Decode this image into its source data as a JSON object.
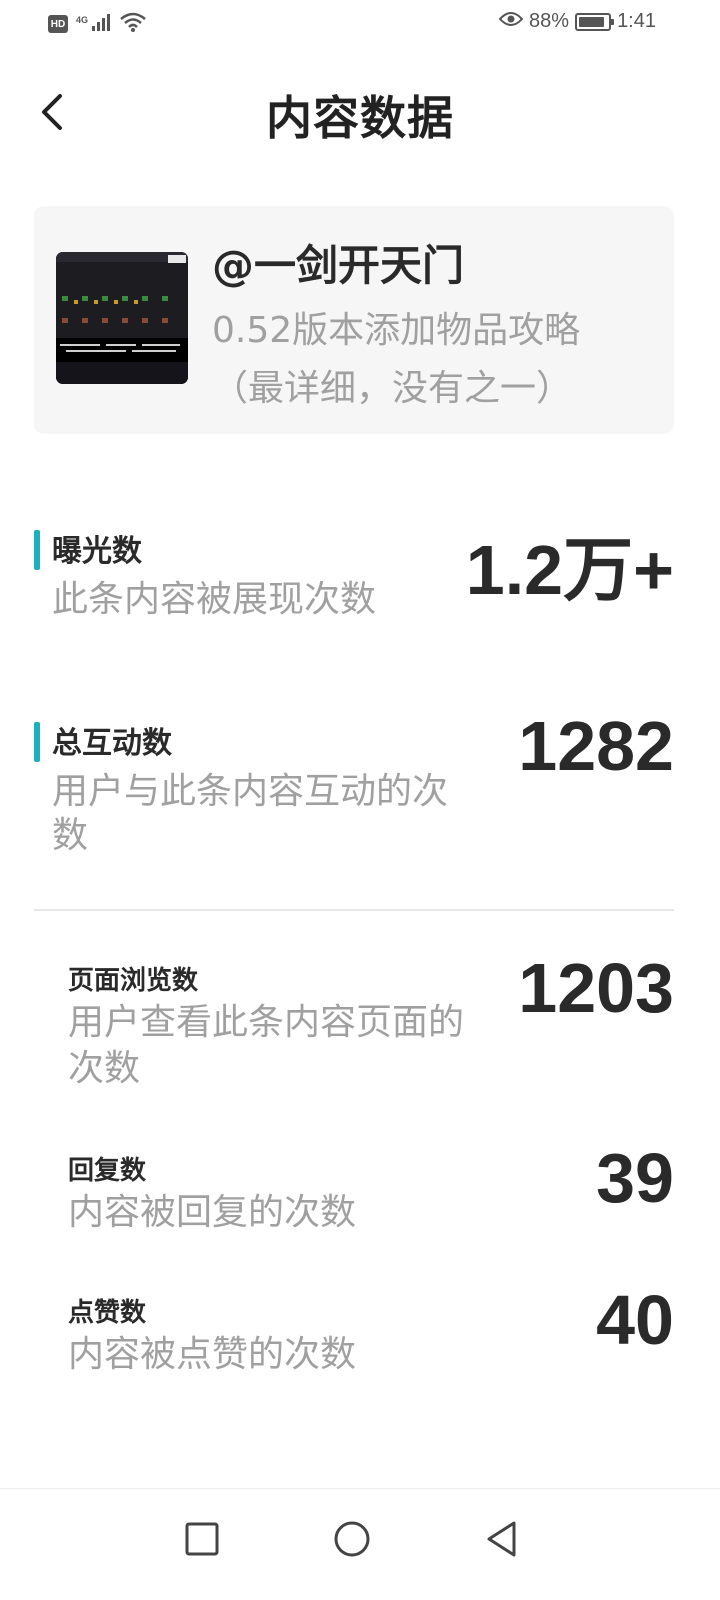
{
  "status_bar": {
    "hd_badge": "HD",
    "network": "4G",
    "battery_percent": "88%",
    "battery_level": 0.88,
    "time": "1:41",
    "icons": [
      "signal-icon",
      "wifi-icon",
      "eye-icon",
      "battery-icon"
    ]
  },
  "header": {
    "title": "内容数据",
    "back_icon": "chevron-left-icon"
  },
  "content_card": {
    "author": "@一剑开天门",
    "title_line1": "0.52版本添加物品攻略",
    "title_line2": "（最详细，没有之一）"
  },
  "metrics": {
    "exposure": {
      "label": "曝光数",
      "desc": "此条内容被展现次数",
      "value": "1.2万+"
    },
    "interactions": {
      "label": "总互动数",
      "desc": "用户与此条内容互动的次数",
      "value": "1282"
    },
    "page_views": {
      "label": "页面浏览数",
      "desc": "用户查看此条内容页面的次数",
      "value": "1203"
    },
    "replies": {
      "label": "回复数",
      "desc": "内容被回复的次数",
      "value": "39"
    },
    "likes": {
      "label": "点赞数",
      "desc": "内容被点赞的次数",
      "value": "40"
    }
  },
  "colors": {
    "accent": "#1ab0be",
    "text_primary": "#2a2a2a",
    "text_secondary": "#a0a0a0",
    "card_bg": "#f6f6f6"
  },
  "nav_bar": {
    "icons": [
      "square-recents-icon",
      "circle-home-icon",
      "triangle-back-icon"
    ]
  }
}
